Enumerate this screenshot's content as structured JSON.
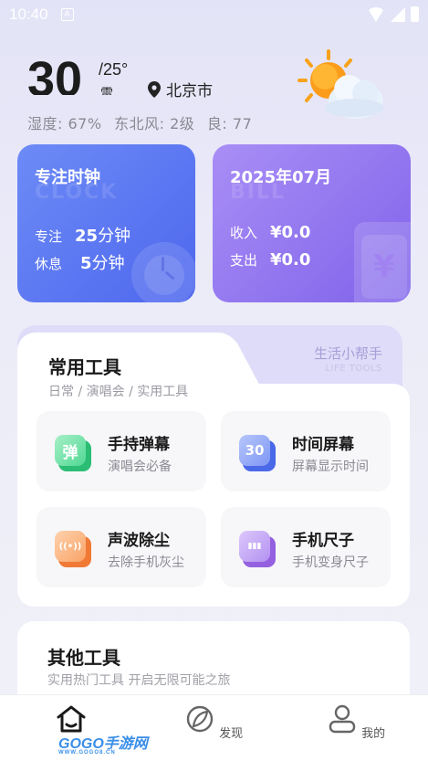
{
  "status_bar": {
    "time": "10:40",
    "notification": "A"
  },
  "weather": {
    "temperature": "30",
    "temperature_low": "/25°",
    "condition": "雷",
    "location": "北京市",
    "humidity": "湿度: 67%",
    "wind": "东北风: 2级",
    "air_quality": "良: 77",
    "icon": "sun-cloud-icon"
  },
  "clock_card": {
    "title": "专注时钟",
    "watermark": "CLOCK",
    "focus_label": "专注",
    "focus_value": "25",
    "focus_unit": "分钟",
    "rest_label": "休息",
    "rest_value": "5",
    "rest_unit": "分钟",
    "color": "#5a74f0"
  },
  "bill_card": {
    "title": "2025年07月",
    "watermark": "BILL",
    "income_label": "收入",
    "income_value": "¥0.0",
    "expense_label": "支出",
    "expense_value": "¥0.0",
    "color": "#8f73ee"
  },
  "tools": {
    "title": "常用工具",
    "subtitle": "日常 / 演唱会 / 实用工具",
    "helper_title": "生活小帮手",
    "helper_en": "LIFE TOOLS",
    "items": [
      {
        "name": "手持弹幕",
        "desc": "演唱会必备",
        "glyph": "弹",
        "icon": "barrage-icon",
        "color": "#3ccf8a"
      },
      {
        "name": "时间屏幕",
        "desc": "屏幕显示时间",
        "glyph": "30",
        "icon": "time-screen-icon",
        "color": "#5b7cf0"
      },
      {
        "name": "声波除尘",
        "desc": "去除手机灰尘",
        "glyph": "((•))",
        "icon": "soundwave-icon",
        "color": "#f5894a"
      },
      {
        "name": "手机尺子",
        "desc": "手机变身尺子",
        "glyph": "▮▮▮",
        "icon": "ruler-icon",
        "color": "#a46ee8"
      }
    ]
  },
  "other_tools": {
    "title": "其他工具",
    "subtitle": "实用热门工具 开启无限可能之旅"
  },
  "bottom_nav": {
    "items": [
      {
        "label": "",
        "icon": "home-icon"
      },
      {
        "label": "发现",
        "icon": "compass-leaf-icon"
      },
      {
        "label": "我的",
        "icon": "user-icon"
      }
    ]
  },
  "watermark": {
    "text": "GOGO手游网",
    "url": "WWW.GOGO8.CN"
  }
}
